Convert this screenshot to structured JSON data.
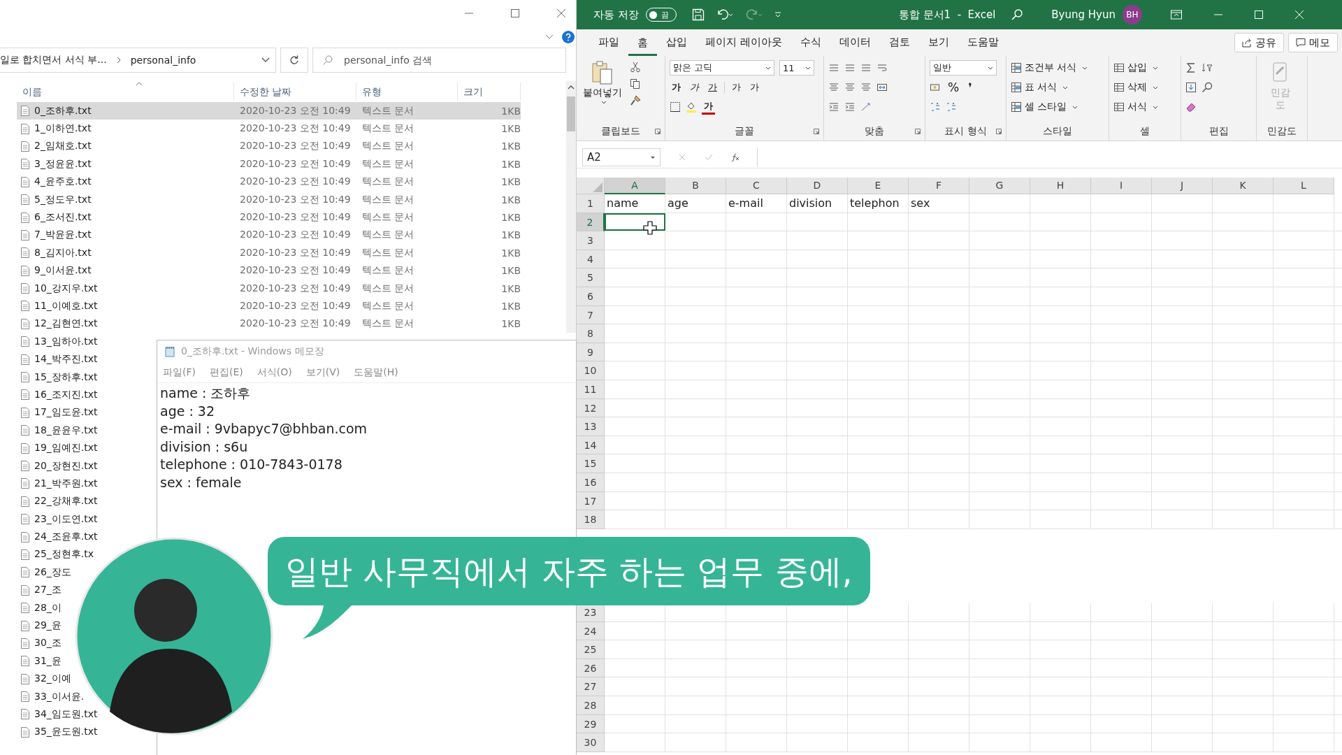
{
  "explorer": {
    "address": [
      "일로 합치면서 서식 부...",
      "personal_info"
    ],
    "search": {
      "placeholder": "personal_info 검색"
    },
    "columns": [
      "이름",
      "수정한 날짜",
      "유형",
      "크기"
    ],
    "files": [
      {
        "name": "0_조하후.txt",
        "date": "2020-10-23 오전 10:49",
        "type": "텍스트 문서",
        "size": "1KB",
        "selected": true
      },
      {
        "name": "1_이하연.txt",
        "date": "2020-10-23 오전 10:49",
        "type": "텍스트 문서",
        "size": "1KB",
        "selected": false
      },
      {
        "name": "2_임채호.txt",
        "date": "2020-10-23 오전 10:49",
        "type": "텍스트 문서",
        "size": "1KB",
        "selected": false
      },
      {
        "name": "3_정윤윤.txt",
        "date": "2020-10-23 오전 10:49",
        "type": "텍스트 문서",
        "size": "1KB",
        "selected": false
      },
      {
        "name": "4_윤주호.txt",
        "date": "2020-10-23 오전 10:49",
        "type": "텍스트 문서",
        "size": "1KB",
        "selected": false
      },
      {
        "name": "5_정도우.txt",
        "date": "2020-10-23 오전 10:49",
        "type": "텍스트 문서",
        "size": "1KB",
        "selected": false
      },
      {
        "name": "6_조서진.txt",
        "date": "2020-10-23 오전 10:49",
        "type": "텍스트 문서",
        "size": "1KB",
        "selected": false
      },
      {
        "name": "7_박윤윤.txt",
        "date": "2020-10-23 오전 10:49",
        "type": "텍스트 문서",
        "size": "1KB",
        "selected": false
      },
      {
        "name": "8_김지아.txt",
        "date": "2020-10-23 오전 10:49",
        "type": "텍스트 문서",
        "size": "1KB",
        "selected": false
      },
      {
        "name": "9_이서윤.txt",
        "date": "2020-10-23 오전 10:49",
        "type": "텍스트 문서",
        "size": "1KB",
        "selected": false
      },
      {
        "name": "10_강지우.txt",
        "date": "2020-10-23 오전 10:49",
        "type": "텍스트 문서",
        "size": "1KB",
        "selected": false
      },
      {
        "name": "11_이예호.txt",
        "date": "2020-10-23 오전 10:49",
        "type": "텍스트 문서",
        "size": "1KB",
        "selected": false
      },
      {
        "name": "12_김현연.txt",
        "date": "2020-10-23 오전 10:49",
        "type": "텍스트 문서",
        "size": "1KB",
        "selected": false
      },
      {
        "name": "13_임하아.txt",
        "selected": false
      },
      {
        "name": "14_박주진.txt",
        "selected": false
      },
      {
        "name": "15_장하후.txt",
        "selected": false
      },
      {
        "name": "16_조지진.txt",
        "selected": false
      },
      {
        "name": "17_임도윤.txt",
        "selected": false
      },
      {
        "name": "18_윤윤우.txt",
        "selected": false
      },
      {
        "name": "19_임예진.txt",
        "selected": false
      },
      {
        "name": "20_장현진.txt",
        "selected": false
      },
      {
        "name": "21_박주원.txt",
        "selected": false
      },
      {
        "name": "22_강채후.txt",
        "selected": false
      },
      {
        "name": "23_이도연.txt",
        "selected": false
      },
      {
        "name": "24_조윤후.txt",
        "selected": false
      },
      {
        "name": "25_정현후.tx",
        "selected": false
      },
      {
        "name": "26_장도",
        "selected": false
      },
      {
        "name": "27_조",
        "selected": false
      },
      {
        "name": "28_이",
        "selected": false
      },
      {
        "name": "29_윤",
        "selected": false
      },
      {
        "name": "30_조",
        "selected": false
      },
      {
        "name": "31_윤",
        "selected": false
      },
      {
        "name": "32_이예",
        "selected": false
      },
      {
        "name": "33_이서윤.",
        "selected": false
      },
      {
        "name": "34_임도원.txt",
        "selected": false
      },
      {
        "name": "35_윤도원.txt",
        "selected": false
      }
    ]
  },
  "notepad": {
    "title": "0_조하후.txt - Windows 메모장",
    "menu": [
      "파일(F)",
      "편집(E)",
      "서식(O)",
      "보기(V)",
      "도움말(H)"
    ],
    "lines": [
      "name : 조하후",
      "age : 32",
      "e-mail : 9vbapyc7@bhban.com",
      "division : s6u",
      "telephone : 010-7843-0178",
      "sex : female"
    ]
  },
  "excel": {
    "autosave_label": "자동 저장",
    "autosave": {
      "on": false,
      "label": "끔"
    },
    "title": "통합 문서1  -  Excel",
    "user": "Byung Hyun",
    "initials": "BH",
    "tabs": [
      {
        "label": "파일",
        "selected": false
      },
      {
        "label": "홈",
        "selected": true
      },
      {
        "label": "삽입",
        "selected": false
      },
      {
        "label": "페이지 레이아웃",
        "selected": false
      },
      {
        "label": "수식",
        "selected": false
      },
      {
        "label": "데이터",
        "selected": false
      },
      {
        "label": "검토",
        "selected": false
      },
      {
        "label": "보기",
        "selected": false
      },
      {
        "label": "도움말",
        "selected": false
      }
    ],
    "share": "공유",
    "comments": "메모",
    "ribbon": {
      "clipboard": {
        "label": "클립보드",
        "paste": "붙여넣기"
      },
      "font": {
        "label": "글꼴",
        "face": "맑은 고딕",
        "size": "11",
        "styles": [
          "가",
          "가",
          "가"
        ],
        "resize": [
          "가",
          "가"
        ],
        "font_color_label": "가"
      },
      "alignment": {
        "label": "맞춤"
      },
      "number": {
        "label": "표시 형식",
        "format": "일반",
        "percent": "%",
        "comma": "❜"
      },
      "styles": {
        "label": "스타일",
        "items": [
          "조건부 서식",
          "표 서식",
          "셀 스타일"
        ]
      },
      "cells": {
        "label": "셀",
        "items": [
          "삽입",
          "삭제",
          "서식"
        ]
      },
      "editing": {
        "label": "편집"
      },
      "sensitivity": {
        "label": "민감도",
        "button": "민감도",
        "disabled": true
      }
    },
    "name_box": "A2",
    "columns": [
      {
        "label": "A",
        "selected": true
      },
      {
        "label": "B",
        "selected": false
      },
      {
        "label": "C",
        "selected": false
      },
      {
        "label": "D",
        "selected": false
      },
      {
        "label": "E",
        "selected": false
      },
      {
        "label": "F",
        "selected": false
      },
      {
        "label": "G",
        "selected": false
      },
      {
        "label": "H",
        "selected": false
      },
      {
        "label": "I",
        "selected": false
      },
      {
        "label": "J",
        "selected": false
      },
      {
        "label": "K",
        "selected": false
      },
      {
        "label": "L",
        "selected": false
      }
    ],
    "header_row": [
      "name",
      "age",
      "e-mail",
      "division",
      "telephon",
      "sex"
    ],
    "rows_top": [
      {
        "number": "1",
        "selected": false
      },
      {
        "number": "2",
        "selected": true
      },
      {
        "number": "3",
        "selected": false
      },
      {
        "number": "4",
        "selected": false
      },
      {
        "number": "5",
        "selected": false
      },
      {
        "number": "6",
        "selected": false
      },
      {
        "number": "7",
        "selected": false
      },
      {
        "number": "8",
        "selected": false
      },
      {
        "number": "9",
        "selected": false
      },
      {
        "number": "10",
        "selected": false
      },
      {
        "number": "11",
        "selected": false
      },
      {
        "number": "12",
        "selected": false
      },
      {
        "number": "13",
        "selected": false
      },
      {
        "number": "14",
        "selected": false
      },
      {
        "number": "15",
        "selected": false
      },
      {
        "number": "16",
        "selected": false
      },
      {
        "number": "17",
        "selected": false
      },
      {
        "number": "18",
        "selected": false
      }
    ],
    "rows_bottom": [
      {
        "number": "23",
        "selected": false
      },
      {
        "number": "24",
        "selected": false
      },
      {
        "number": "25",
        "selected": false
      },
      {
        "number": "26",
        "selected": false
      },
      {
        "number": "27",
        "selected": false
      },
      {
        "number": "28",
        "selected": false
      },
      {
        "number": "29",
        "selected": false
      },
      {
        "number": "30",
        "selected": false
      }
    ]
  },
  "caption": "일반 사무직에서 자주 하는 업무 중에,"
}
